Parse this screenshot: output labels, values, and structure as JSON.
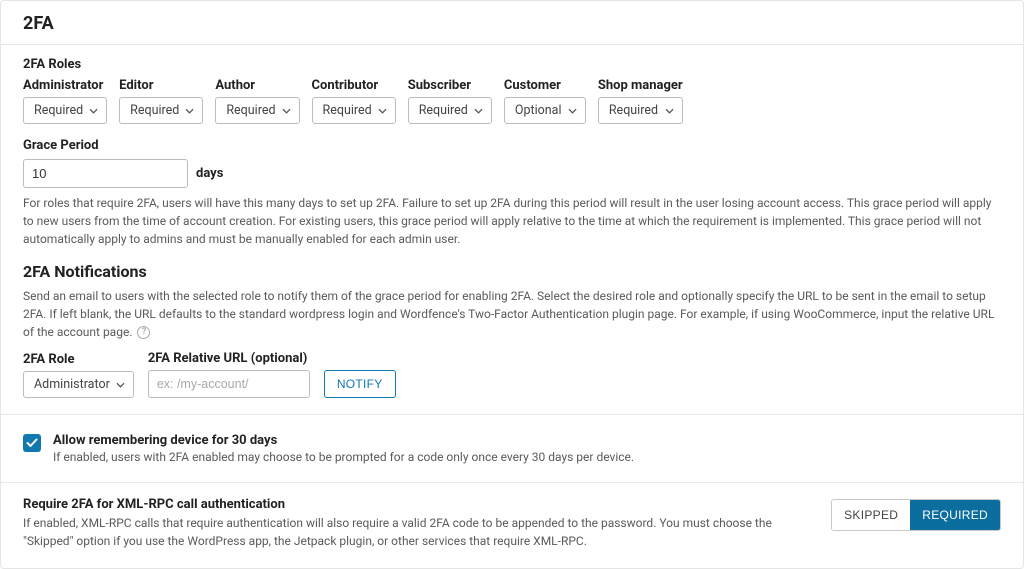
{
  "header": {
    "title": "2FA"
  },
  "roles_section": {
    "heading": "2FA Roles",
    "roles": [
      {
        "label": "Administrator",
        "value": "Required"
      },
      {
        "label": "Editor",
        "value": "Required"
      },
      {
        "label": "Author",
        "value": "Required"
      },
      {
        "label": "Contributor",
        "value": "Required"
      },
      {
        "label": "Subscriber",
        "value": "Required"
      },
      {
        "label": "Customer",
        "value": "Optional"
      },
      {
        "label": "Shop manager",
        "value": "Required"
      }
    ]
  },
  "grace": {
    "heading": "Grace Period",
    "value": "10",
    "unit": "days",
    "help": "For roles that require 2FA, users will have this many days to set up 2FA. Failure to set up 2FA during this period will result in the user losing account access. This grace period will apply to new users from the time of account creation. For existing users, this grace period will apply relative to the time at which the requirement is implemented. This grace period will not automatically apply to admins and must be manually enabled for each admin user."
  },
  "notifications": {
    "heading": "2FA Notifications",
    "help": "Send an email to users with the selected role to notify them of the grace period for enabling 2FA. Select the desired role and optionally specify the URL to be sent in the email to setup 2FA. If left blank, the URL defaults to the standard wordpress login and Wordfence's Two-Factor Authentication plugin page. For example, if using WooCommerce, input the relative URL of the account page.",
    "role_label": "2FA Role",
    "role_value": "Administrator",
    "url_label": "2FA Relative URL (optional)",
    "url_placeholder": "ex: /my-account/",
    "notify_label": "NOTIFY"
  },
  "remember": {
    "title": "Allow remembering device for 30 days",
    "desc": "If enabled, users with 2FA enabled may choose to be prompted for a code only once every 30 days per device.",
    "checked": true
  },
  "xmlrpc": {
    "title": "Require 2FA for XML-RPC call authentication",
    "desc": "If enabled, XML-RPC calls that require authentication will also require a valid 2FA code to be appended to the password. You must choose the \"Skipped\" option if you use the WordPress app, the Jetpack plugin, or other services that require XML-RPC.",
    "skipped_label": "SKIPPED",
    "required_label": "REQUIRED"
  }
}
